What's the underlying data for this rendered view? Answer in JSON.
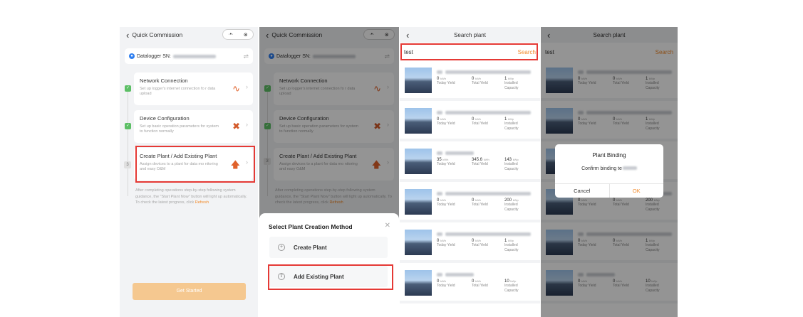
{
  "screen1": {
    "title": "Quick Commission",
    "datalogger_label": "Datalogger SN:",
    "steps": [
      {
        "title": "Network Connection",
        "desc": "Set up logger's internet connection fo r data upload",
        "status": "done"
      },
      {
        "title": "Device Configuration",
        "desc": "Set up basic operation parameters for system to function normally",
        "status": "done"
      },
      {
        "title": "Create Plant / Add Existing Plant",
        "desc": "Assign devices to a plant for data mo nitoring and easy O&M",
        "status": "3"
      }
    ],
    "hint_text": "After completing operations step-by-step following system guidance, the \"Start Plant Now\" button will light up automatically. To check the latest progress, click",
    "refresh_label": "Refresh",
    "start_button": "Get Started"
  },
  "screen2": {
    "title": "Quick Commission",
    "sheet_title": "Select Plant Creation Method",
    "options": [
      "Create Plant",
      "Add Existing Plant"
    ]
  },
  "screen3": {
    "title": "Search plant",
    "search_value": "test",
    "search_button": "Search",
    "stat_labels": [
      "Today Yield",
      "Total Yield",
      "Installed Capacity"
    ],
    "plants": [
      {
        "today": "0",
        "today_unit": "kWh",
        "total": "0",
        "total_unit": "kWh",
        "capacity": "1",
        "capacity_unit": "kWp"
      },
      {
        "today": "0",
        "today_unit": "kWh",
        "total": "0",
        "total_unit": "kWh",
        "capacity": "1",
        "capacity_unit": "kWp"
      },
      {
        "today": "35",
        "today_unit": "kWh",
        "total": "345.6",
        "total_unit": "kWh",
        "capacity": "143",
        "capacity_unit": "kWp"
      },
      {
        "today": "0",
        "today_unit": "kWh",
        "total": "0",
        "total_unit": "kWh",
        "capacity": "200",
        "capacity_unit": "kWp"
      },
      {
        "today": "0",
        "today_unit": "kWh",
        "total": "0",
        "total_unit": "kWh",
        "capacity": "1",
        "capacity_unit": "kWp"
      },
      {
        "today": "0",
        "today_unit": "kWh",
        "total": "0",
        "total_unit": "kWh",
        "capacity": "10",
        "capacity_unit": "kWp"
      }
    ]
  },
  "screen4": {
    "title": "Search plant",
    "search_value": "test",
    "search_button": "Search",
    "dialog_title": "Plant Binding",
    "dialog_message": "Confirm binding te",
    "cancel_label": "Cancel",
    "ok_label": "OK"
  },
  "colors": {
    "accent": "#f28b2c",
    "highlight": "#e53935",
    "success": "#5cbf65",
    "info": "#2f7ff0"
  }
}
